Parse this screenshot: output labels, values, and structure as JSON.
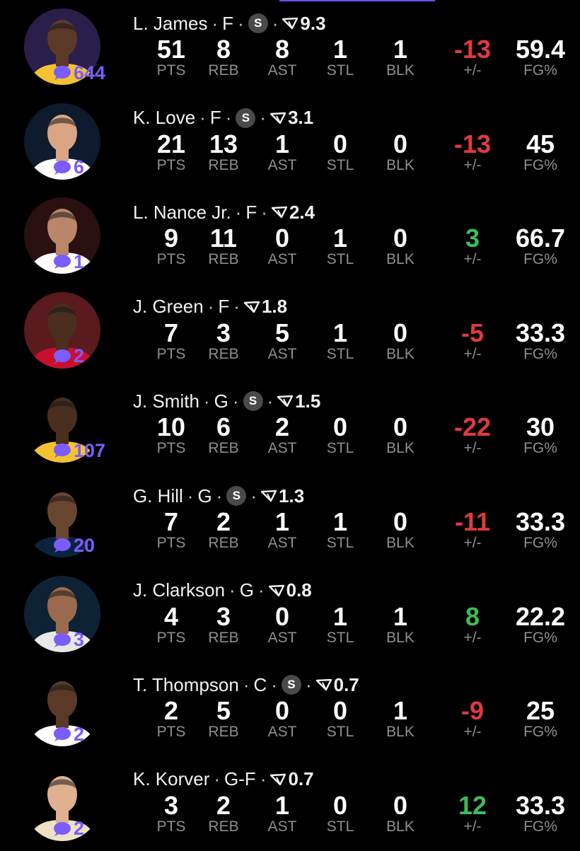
{
  "players": [
    {
      "name": "L. James",
      "pos": "F",
      "starter": true,
      "rating": "9.3",
      "comments": "644",
      "jersey": "#f4c230",
      "skin": "#5a3a27",
      "bg": "#2a1f4a",
      "stats": {
        "pts": "51",
        "reb": "8",
        "ast": "8",
        "stl": "1",
        "blk": "1",
        "pm": "-13",
        "fg": "59.4"
      },
      "pm_sign": "neg"
    },
    {
      "name": "K. Love",
      "pos": "F",
      "starter": true,
      "rating": "3.1",
      "comments": "6",
      "jersey": "#ffffff",
      "skin": "#d9a585",
      "bg": "#0e1a2e",
      "stats": {
        "pts": "21",
        "reb": "13",
        "ast": "1",
        "stl": "0",
        "blk": "0",
        "pm": "-13",
        "fg": "45"
      },
      "pm_sign": "neg"
    },
    {
      "name": "L. Nance Jr.",
      "pos": "F",
      "starter": false,
      "rating": "2.4",
      "comments": "1",
      "jersey": "#ffffff",
      "skin": "#b9866a",
      "bg": "#2a1010",
      "stats": {
        "pts": "9",
        "reb": "11",
        "ast": "0",
        "stl": "1",
        "blk": "0",
        "pm": "3",
        "fg": "66.7"
      },
      "pm_sign": "pos"
    },
    {
      "name": "J. Green",
      "pos": "F",
      "starter": false,
      "rating": "1.8",
      "comments": "2",
      "jersey": "#c8102e",
      "skin": "#4a2e1e",
      "bg": "#5a1a1e",
      "stats": {
        "pts": "7",
        "reb": "3",
        "ast": "5",
        "stl": "1",
        "blk": "0",
        "pm": "-5",
        "fg": "33.3"
      },
      "pm_sign": "neg"
    },
    {
      "name": "J. Smith",
      "pos": "G",
      "starter": true,
      "rating": "1.5",
      "comments": "107",
      "jersey": "#f4c230",
      "skin": "#4a2e1e",
      "bg": "#000000",
      "stats": {
        "pts": "10",
        "reb": "6",
        "ast": "2",
        "stl": "0",
        "blk": "0",
        "pm": "-22",
        "fg": "30"
      },
      "pm_sign": "neg"
    },
    {
      "name": "G. Hill",
      "pos": "G",
      "starter": true,
      "rating": "1.3",
      "comments": "20",
      "jersey": "#0c2340",
      "skin": "#6a4530",
      "bg": "#000000",
      "stats": {
        "pts": "7",
        "reb": "2",
        "ast": "1",
        "stl": "1",
        "blk": "0",
        "pm": "-11",
        "fg": "33.3"
      },
      "pm_sign": "neg"
    },
    {
      "name": "J. Clarkson",
      "pos": "G",
      "starter": false,
      "rating": "0.8",
      "comments": "3",
      "jersey": "#e8e8e8",
      "skin": "#9b6a4c",
      "bg": "#0e2236",
      "stats": {
        "pts": "4",
        "reb": "3",
        "ast": "0",
        "stl": "1",
        "blk": "1",
        "pm": "8",
        "fg": "22.2"
      },
      "pm_sign": "pos"
    },
    {
      "name": "T. Thompson",
      "pos": "C",
      "starter": true,
      "rating": "0.7",
      "comments": "2",
      "jersey": "#ffffff",
      "skin": "#5a3a27",
      "bg": "#000000",
      "stats": {
        "pts": "2",
        "reb": "5",
        "ast": "0",
        "stl": "0",
        "blk": "1",
        "pm": "-9",
        "fg": "25"
      },
      "pm_sign": "neg"
    },
    {
      "name": "K. Korver",
      "pos": "G-F",
      "starter": false,
      "rating": "0.7",
      "comments": "2",
      "jersey": "#eee1c6",
      "skin": "#e0b091",
      "bg": "#000000",
      "stats": {
        "pts": "3",
        "reb": "2",
        "ast": "1",
        "stl": "0",
        "blk": "0",
        "pm": "12",
        "fg": "33.3"
      },
      "pm_sign": "pos"
    }
  ],
  "labels": {
    "pts": "PTS",
    "reb": "REB",
    "ast": "AST",
    "stl": "STL",
    "blk": "BLK",
    "pm": "+/-",
    "fg": "FG%"
  },
  "dot": "·",
  "starter_badge": "S",
  "accent": "#7b5cff"
}
